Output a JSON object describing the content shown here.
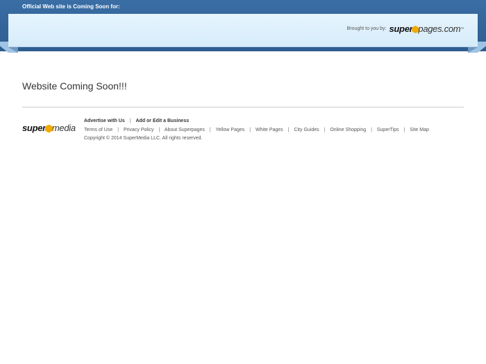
{
  "topbar": {
    "title": "Official Web site is Coming Soon for:"
  },
  "banner": {
    "brought_label": "Brought to you by:",
    "logo": {
      "part1": "super",
      "part2": "pages.com",
      "tm": "™"
    }
  },
  "main": {
    "headline": "Website Coming Soon!!!"
  },
  "footer": {
    "logo": {
      "part1": "super",
      "part2": "media"
    },
    "primary_links": [
      "Advertise with Us",
      "Add or Edit a Business"
    ],
    "secondary_links": [
      "Terms of Use",
      "Privacy Policy",
      "About Superpages",
      "Yellow Pages",
      "White Pages",
      "City Guides",
      "Online Shopping",
      "SuperTips",
      "Site Map"
    ],
    "separator": "|",
    "copyright": "Copyright © 2014 SuperMedia LLC. All rights reserved."
  },
  "colors": {
    "topbar": "#2e5d90",
    "banner": "#dff0fc",
    "logo_accent": "#f2a900"
  }
}
